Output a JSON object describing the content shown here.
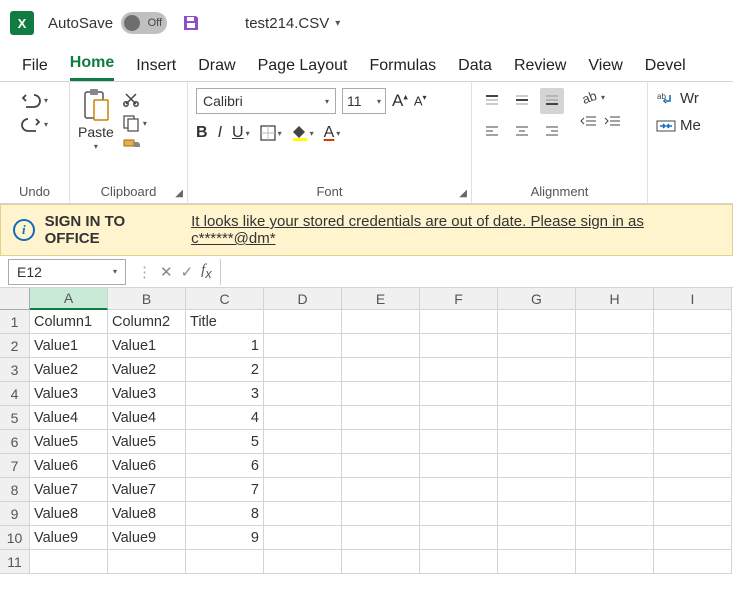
{
  "title": {
    "autosave_label": "AutoSave",
    "autosave_state": "Off",
    "filename": "test214.CSV"
  },
  "tabs": [
    "File",
    "Home",
    "Insert",
    "Draw",
    "Page Layout",
    "Formulas",
    "Data",
    "Review",
    "View",
    "Devel"
  ],
  "active_tab": 1,
  "ribbon": {
    "undo_group": "Undo",
    "clipboard_group": "Clipboard",
    "paste_label": "Paste",
    "font_group": "Font",
    "font_name": "Calibri",
    "font_size": "11",
    "align_group": "Alignment",
    "wrap_label": "Wr",
    "merge_label": "Me"
  },
  "banner": {
    "title": "SIGN IN TO OFFICE",
    "message": "It looks like your stored credentials are out of date. Please sign in as c******@dm*"
  },
  "namebox": "E12",
  "formula": "",
  "columns": [
    "A",
    "B",
    "C",
    "D",
    "E",
    "F",
    "G",
    "H",
    "I"
  ],
  "selected_col": "A",
  "selected_cell": "E12",
  "rows": [
    {
      "n": 1,
      "cells": [
        "Column1",
        "Column2",
        "Title",
        "",
        "",
        "",
        "",
        "",
        ""
      ]
    },
    {
      "n": 2,
      "cells": [
        "Value1",
        "Value1",
        "1",
        "",
        "",
        "",
        "",
        "",
        ""
      ]
    },
    {
      "n": 3,
      "cells": [
        "Value2",
        "Value2",
        "2",
        "",
        "",
        "",
        "",
        "",
        ""
      ]
    },
    {
      "n": 4,
      "cells": [
        "Value3",
        "Value3",
        "3",
        "",
        "",
        "",
        "",
        "",
        ""
      ]
    },
    {
      "n": 5,
      "cells": [
        "Value4",
        "Value4",
        "4",
        "",
        "",
        "",
        "",
        "",
        ""
      ]
    },
    {
      "n": 6,
      "cells": [
        "Value5",
        "Value5",
        "5",
        "",
        "",
        "",
        "",
        "",
        ""
      ]
    },
    {
      "n": 7,
      "cells": [
        "Value6",
        "Value6",
        "6",
        "",
        "",
        "",
        "",
        "",
        ""
      ]
    },
    {
      "n": 8,
      "cells": [
        "Value7",
        "Value7",
        "7",
        "",
        "",
        "",
        "",
        "",
        ""
      ]
    },
    {
      "n": 9,
      "cells": [
        "Value8",
        "Value8",
        "8",
        "",
        "",
        "",
        "",
        "",
        ""
      ]
    },
    {
      "n": 10,
      "cells": [
        "Value9",
        "Value9",
        "9",
        "",
        "",
        "",
        "",
        "",
        ""
      ]
    },
    {
      "n": 11,
      "cells": [
        "",
        "",
        "",
        "",
        "",
        "",
        "",
        "",
        ""
      ]
    }
  ]
}
